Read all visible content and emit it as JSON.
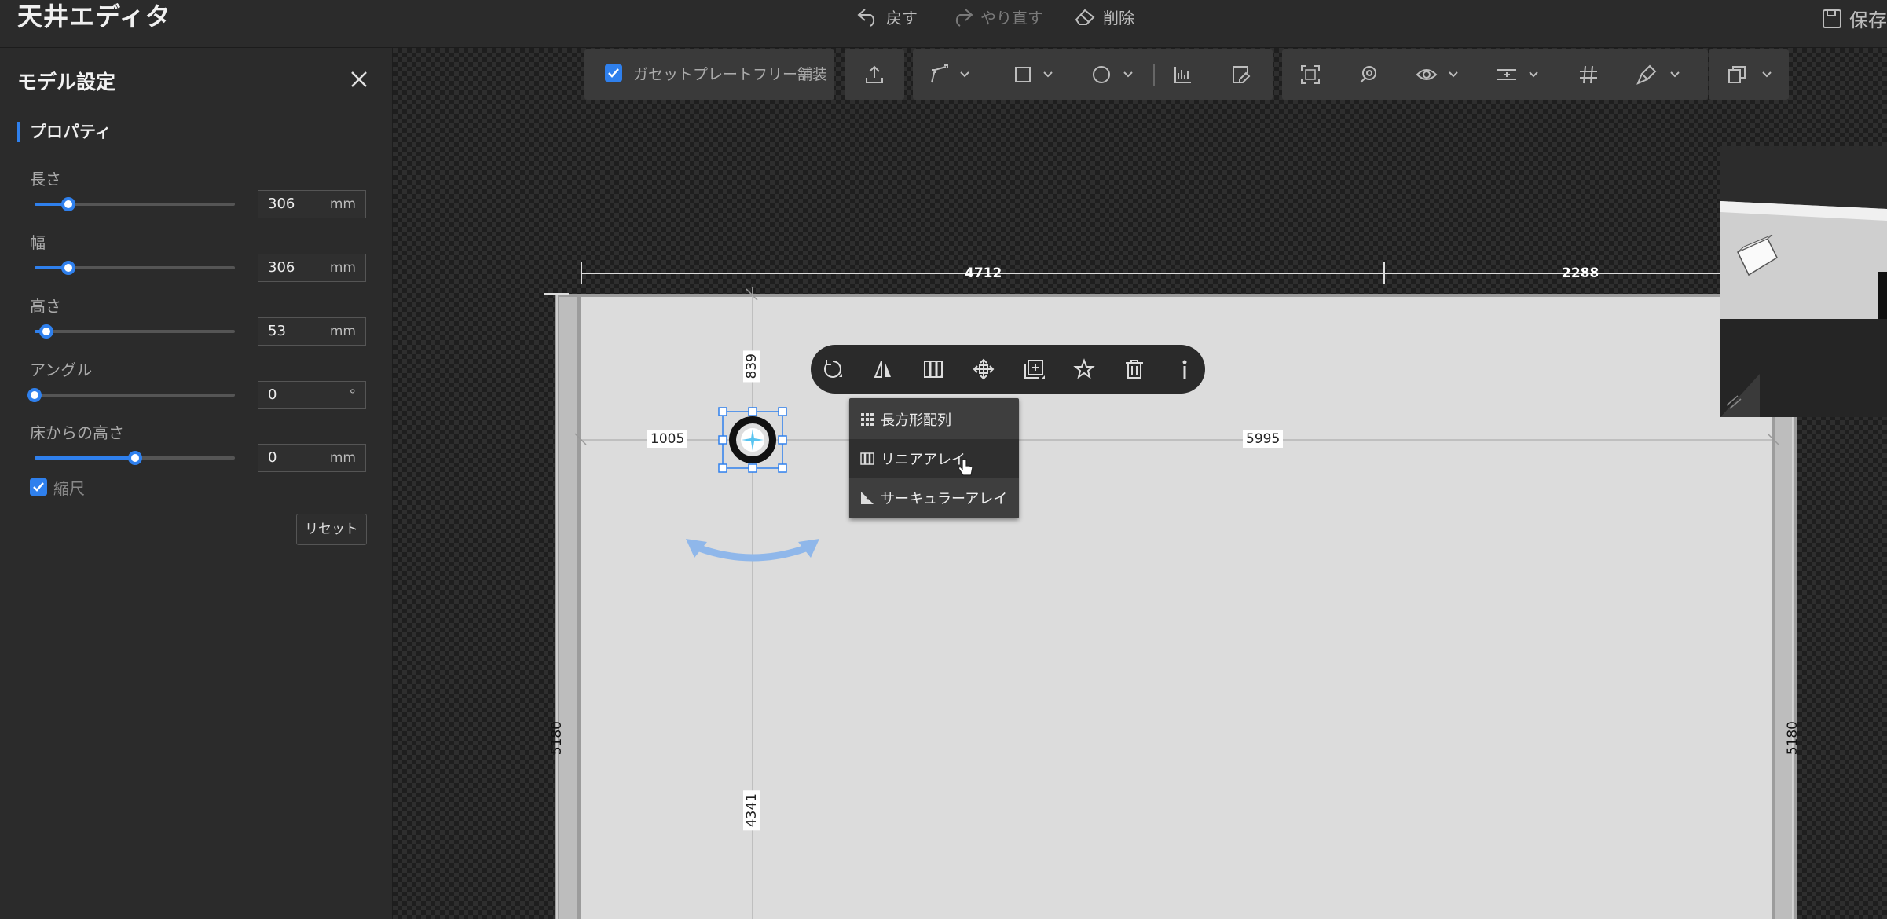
{
  "app": {
    "title": "天井エディタ"
  },
  "topbar": {
    "undo_label": "戻す",
    "redo_label": "やり直す",
    "delete_label": "削除",
    "save_label": "保存"
  },
  "panel": {
    "title": "モデル設定",
    "section": "プロパティ",
    "properties": [
      {
        "label": "長さ",
        "value": "306",
        "unit": "mm",
        "slider": 0.17
      },
      {
        "label": "幅",
        "value": "306",
        "unit": "mm",
        "slider": 0.17
      },
      {
        "label": "高さ",
        "value": "53",
        "unit": "mm",
        "slider": 0.06
      },
      {
        "label": "アングル",
        "value": "0",
        "unit": "°",
        "slider": 0.0
      },
      {
        "label": "床からの高さ",
        "value": "0",
        "unit": "mm",
        "slider": 0.5
      }
    ],
    "scale_label": "縮尺",
    "scale_checked": true,
    "reset_label": "リセット"
  },
  "toolbar": {
    "gusset_label": "ガセットプレートフリー舗装",
    "gusset_checked": true,
    "icons": [
      "upload-icon",
      "draw-path-icon",
      "rectangle-icon",
      "circle-icon",
      "measure-icon",
      "edit-area-icon",
      "fit-view-icon",
      "target-icon",
      "eye-icon",
      "align-icon",
      "grid-icon",
      "paint-icon",
      "layers-icon"
    ]
  },
  "dimensions": {
    "top_left": "4712",
    "top_right": "2288",
    "left_offset": "1005",
    "right_offset": "5995",
    "top_offset": "839",
    "bottom_offset": "4341",
    "left_height": "5180",
    "right_height": "5180"
  },
  "float_toolbar": {
    "icons": [
      "rotate-icon",
      "mirror-icon",
      "array-icon",
      "move-icon",
      "duplicate-icon",
      "favorite-icon",
      "trash-icon",
      "info-icon"
    ]
  },
  "array_menu": {
    "items": [
      {
        "label": "長方形配列",
        "icon": "grid-array-icon"
      },
      {
        "label": "リニアアレイ",
        "icon": "linear-array-icon"
      },
      {
        "label": "サーキュラーアレイ",
        "icon": "circular-array-icon"
      }
    ]
  },
  "colors": {
    "accent": "#2f80ed",
    "background": "#2b2b2b",
    "floor": "#dcdcdc"
  }
}
